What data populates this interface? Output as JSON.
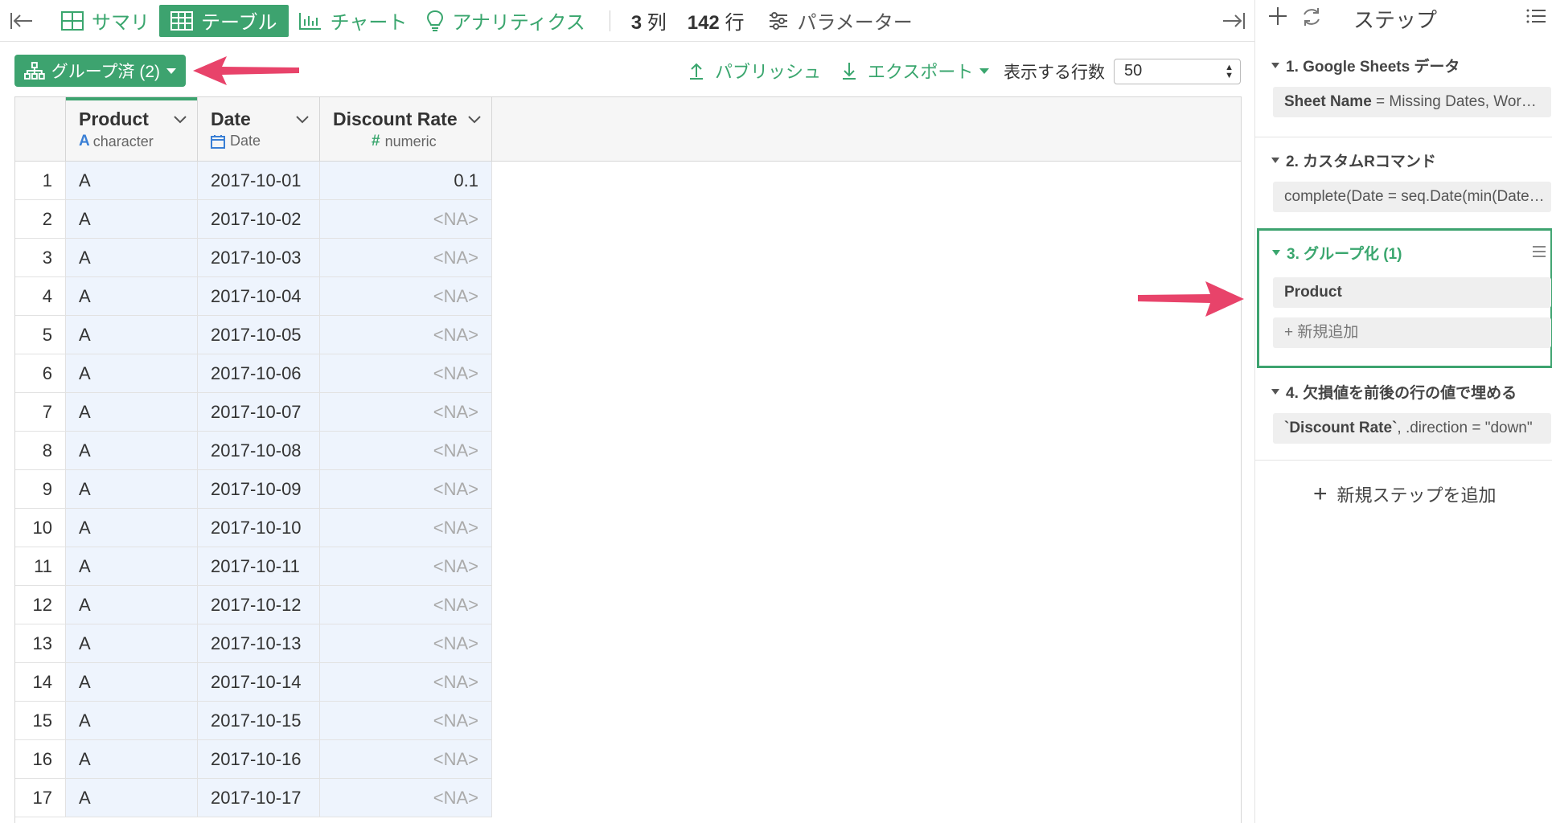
{
  "toolbar": {
    "summary_label": "サマリ",
    "table_label": "テーブル",
    "chart_label": "チャート",
    "analytics_label": "アナリティクス",
    "columns_count": "3",
    "columns_unit": "列",
    "rows_count": "142",
    "rows_unit": "行",
    "parameters_label": "パラメーター"
  },
  "actions": {
    "group_label": "グループ済 (2)",
    "publish_label": "パブリッシュ",
    "export_label": "エクスポート",
    "rows_display_label": "表示する行数",
    "rows_display_value": "50"
  },
  "table": {
    "columns": [
      {
        "name": "Product",
        "type_icon": "A",
        "type": "character"
      },
      {
        "name": "Date",
        "type_icon": "calendar-icon",
        "type": "Date"
      },
      {
        "name": "Discount Rate",
        "type_icon": "#",
        "type": "numeric"
      }
    ],
    "rows": [
      {
        "idx": "1",
        "product": "A",
        "date": "2017-10-01",
        "rate": "0.1"
      },
      {
        "idx": "2",
        "product": "A",
        "date": "2017-10-02",
        "rate": "<NA>"
      },
      {
        "idx": "3",
        "product": "A",
        "date": "2017-10-03",
        "rate": "<NA>"
      },
      {
        "idx": "4",
        "product": "A",
        "date": "2017-10-04",
        "rate": "<NA>"
      },
      {
        "idx": "5",
        "product": "A",
        "date": "2017-10-05",
        "rate": "<NA>"
      },
      {
        "idx": "6",
        "product": "A",
        "date": "2017-10-06",
        "rate": "<NA>"
      },
      {
        "idx": "7",
        "product": "A",
        "date": "2017-10-07",
        "rate": "<NA>"
      },
      {
        "idx": "8",
        "product": "A",
        "date": "2017-10-08",
        "rate": "<NA>"
      },
      {
        "idx": "9",
        "product": "A",
        "date": "2017-10-09",
        "rate": "<NA>"
      },
      {
        "idx": "10",
        "product": "A",
        "date": "2017-10-10",
        "rate": "<NA>"
      },
      {
        "idx": "11",
        "product": "A",
        "date": "2017-10-11",
        "rate": "<NA>"
      },
      {
        "idx": "12",
        "product": "A",
        "date": "2017-10-12",
        "rate": "<NA>"
      },
      {
        "idx": "13",
        "product": "A",
        "date": "2017-10-13",
        "rate": "<NA>"
      },
      {
        "idx": "14",
        "product": "A",
        "date": "2017-10-14",
        "rate": "<NA>"
      },
      {
        "idx": "15",
        "product": "A",
        "date": "2017-10-15",
        "rate": "<NA>"
      },
      {
        "idx": "16",
        "product": "A",
        "date": "2017-10-16",
        "rate": "<NA>"
      },
      {
        "idx": "17",
        "product": "A",
        "date": "2017-10-17",
        "rate": "<NA>"
      }
    ]
  },
  "steps_panel": {
    "title": "ステップ",
    "steps": [
      {
        "title": "1. Google Sheets データ",
        "detail_key": "Sheet Name",
        "detail_rest": " = Missing Dates, Wor…"
      },
      {
        "title": "2. カスタムRコマンド",
        "detail_key": "",
        "detail_rest": "complete(Date = seq.Date(min(Date…"
      },
      {
        "title": "3. グループ化 (1)",
        "detail_key": "Product",
        "detail_rest": "",
        "add_label": "+ 新規追加"
      },
      {
        "title": "4. 欠損値を前後の行の値で埋める",
        "detail_key": "`Discount Rate`",
        "detail_rest": ", .direction = \"down\""
      }
    ],
    "add_step_label": "新規ステップを追加"
  },
  "colors": {
    "accent": "#3da36f",
    "annotation_arrow": "#e8436a",
    "cell_bg": "#eef4fd"
  }
}
